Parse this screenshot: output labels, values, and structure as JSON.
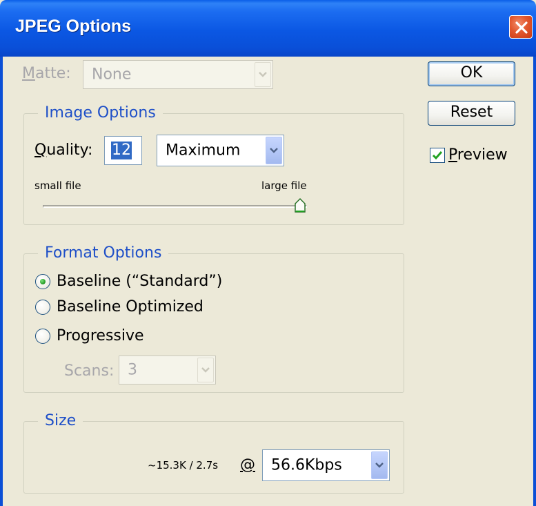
{
  "window": {
    "title": "JPEG Options",
    "close_icon": "close-icon"
  },
  "matte": {
    "label": "Matte:",
    "value": "None",
    "enabled": false
  },
  "buttons": {
    "ok_label": "OK",
    "reset_label": "Reset"
  },
  "preview": {
    "label": "Preview",
    "checked": true
  },
  "image_options": {
    "legend": "Image Options",
    "quality_label": "Quality:",
    "quality_value": "12",
    "quality_preset": "Maximum",
    "slider_min_label": "small file",
    "slider_max_label": "large file",
    "slider_level": 1.0
  },
  "format_options": {
    "legend": "Format Options",
    "options": [
      {
        "label": "Baseline (“Standard”)",
        "selected": true
      },
      {
        "label": "Baseline Optimized",
        "selected": false
      },
      {
        "label": "Progressive",
        "selected": false
      }
    ],
    "scans_label": "Scans:",
    "scans_value": "3",
    "scans_enabled": false
  },
  "size": {
    "legend": "Size",
    "estimate": "~15.3K / 2.7s",
    "at_symbol": "@",
    "connection_speed": "56.6Kbps"
  },
  "colors": {
    "title_bar": "#0b57e3",
    "legend_text": "#1e4fc8",
    "dialog_bg": "#ece9d8",
    "check_mark": "#21a121"
  }
}
